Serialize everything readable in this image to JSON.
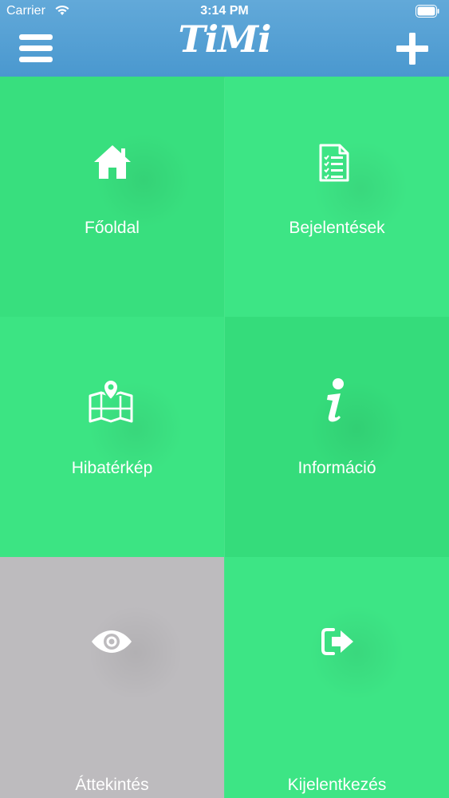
{
  "status_bar": {
    "carrier": "Carrier",
    "time": "3:14 PM"
  },
  "header": {
    "logo_text": "TiMi"
  },
  "tiles": [
    {
      "label": "Főoldal",
      "icon": "home-icon"
    },
    {
      "label": "Bejelentések",
      "icon": "document-checklist-icon"
    },
    {
      "label": "Hibatérkép",
      "icon": "map-pin-icon"
    },
    {
      "label": "Információ",
      "icon": "info-icon"
    },
    {
      "label": "Áttekintés",
      "icon": "eye-icon"
    },
    {
      "label": "Kijelentkezés",
      "icon": "logout-icon"
    }
  ],
  "colors": {
    "header": "#5aa3d6",
    "tile_green": "#3de382",
    "tile_gray": "#bdbbbe",
    "text": "#ffffff"
  }
}
